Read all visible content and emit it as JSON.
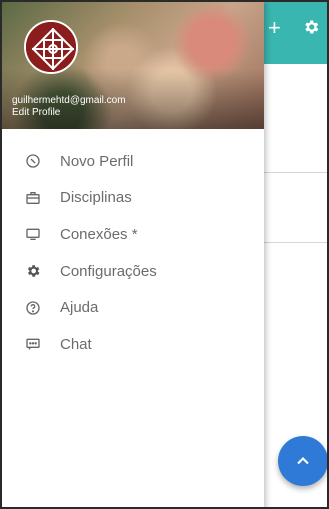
{
  "header": {
    "email": "guilhermehtd@gmail.com",
    "edit_profile_label": "Edit Profile",
    "avatar_icon": "logo-avatar-icon"
  },
  "menu": {
    "items": [
      {
        "label": "Novo Perfil",
        "icon": "compass-icon"
      },
      {
        "label": "Disciplinas",
        "icon": "briefcase-icon"
      },
      {
        "label": "Conexões *",
        "icon": "monitor-icon"
      },
      {
        "label": "Configurações",
        "icon": "gear-icon"
      },
      {
        "label": "Ajuda",
        "icon": "help-circle-icon"
      },
      {
        "label": "Chat",
        "icon": "chat-icon"
      }
    ]
  },
  "appbar": {
    "add_icon": "plus-icon",
    "settings_icon": "gear-icon",
    "color": "#3ab6b0"
  },
  "fab": {
    "icon": "chevron-up-icon",
    "color": "#2f7ad6"
  }
}
